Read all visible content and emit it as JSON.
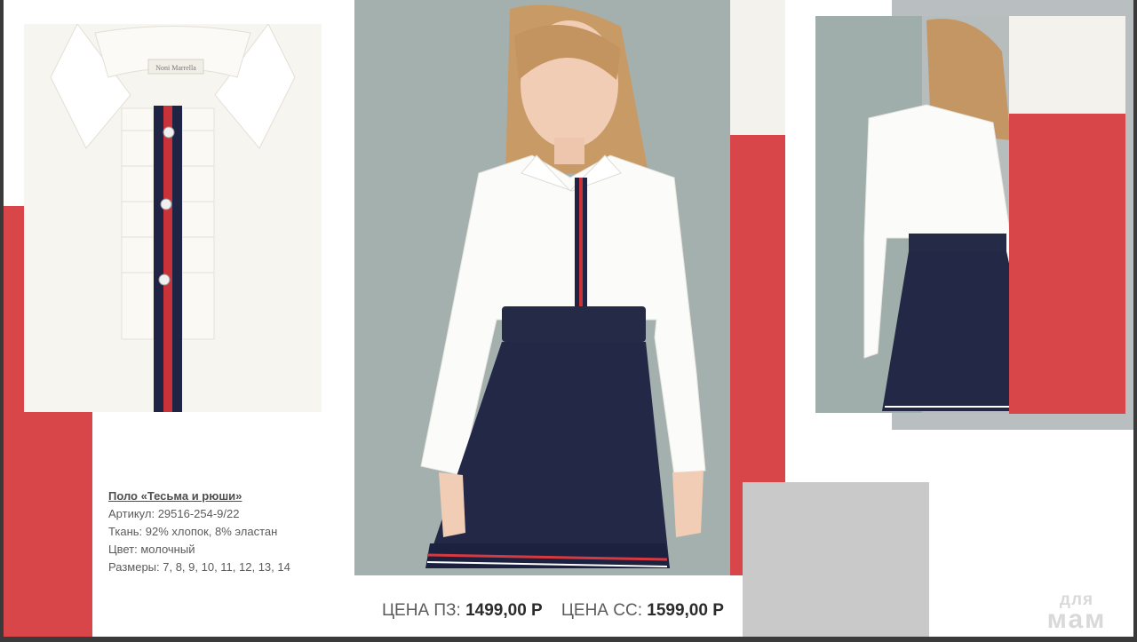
{
  "product": {
    "title": "Поло «Тесьма и рюши»",
    "article": "Артикул: 29516-254-9/22",
    "fabric": "Ткань: 92% хлопок, 8% эластан",
    "color": "Цвет: молочный",
    "sizes": "Размеры: 7, 8, 9, 10, 11, 12, 13, 14"
  },
  "prices": {
    "pz_label": "ЦЕНА ПЗ:",
    "pz_value": "1499,00 Р",
    "ss_label": "ЦЕНА СС:",
    "ss_value": "1599,00 Р"
  },
  "collar_label_text": "Noni Marrella",
  "watermark": {
    "small": "для",
    "big": "мам"
  },
  "colors": {
    "accent_red": "#d9464a",
    "navy": "#1f2344",
    "ivory": "#f7f6f1"
  }
}
